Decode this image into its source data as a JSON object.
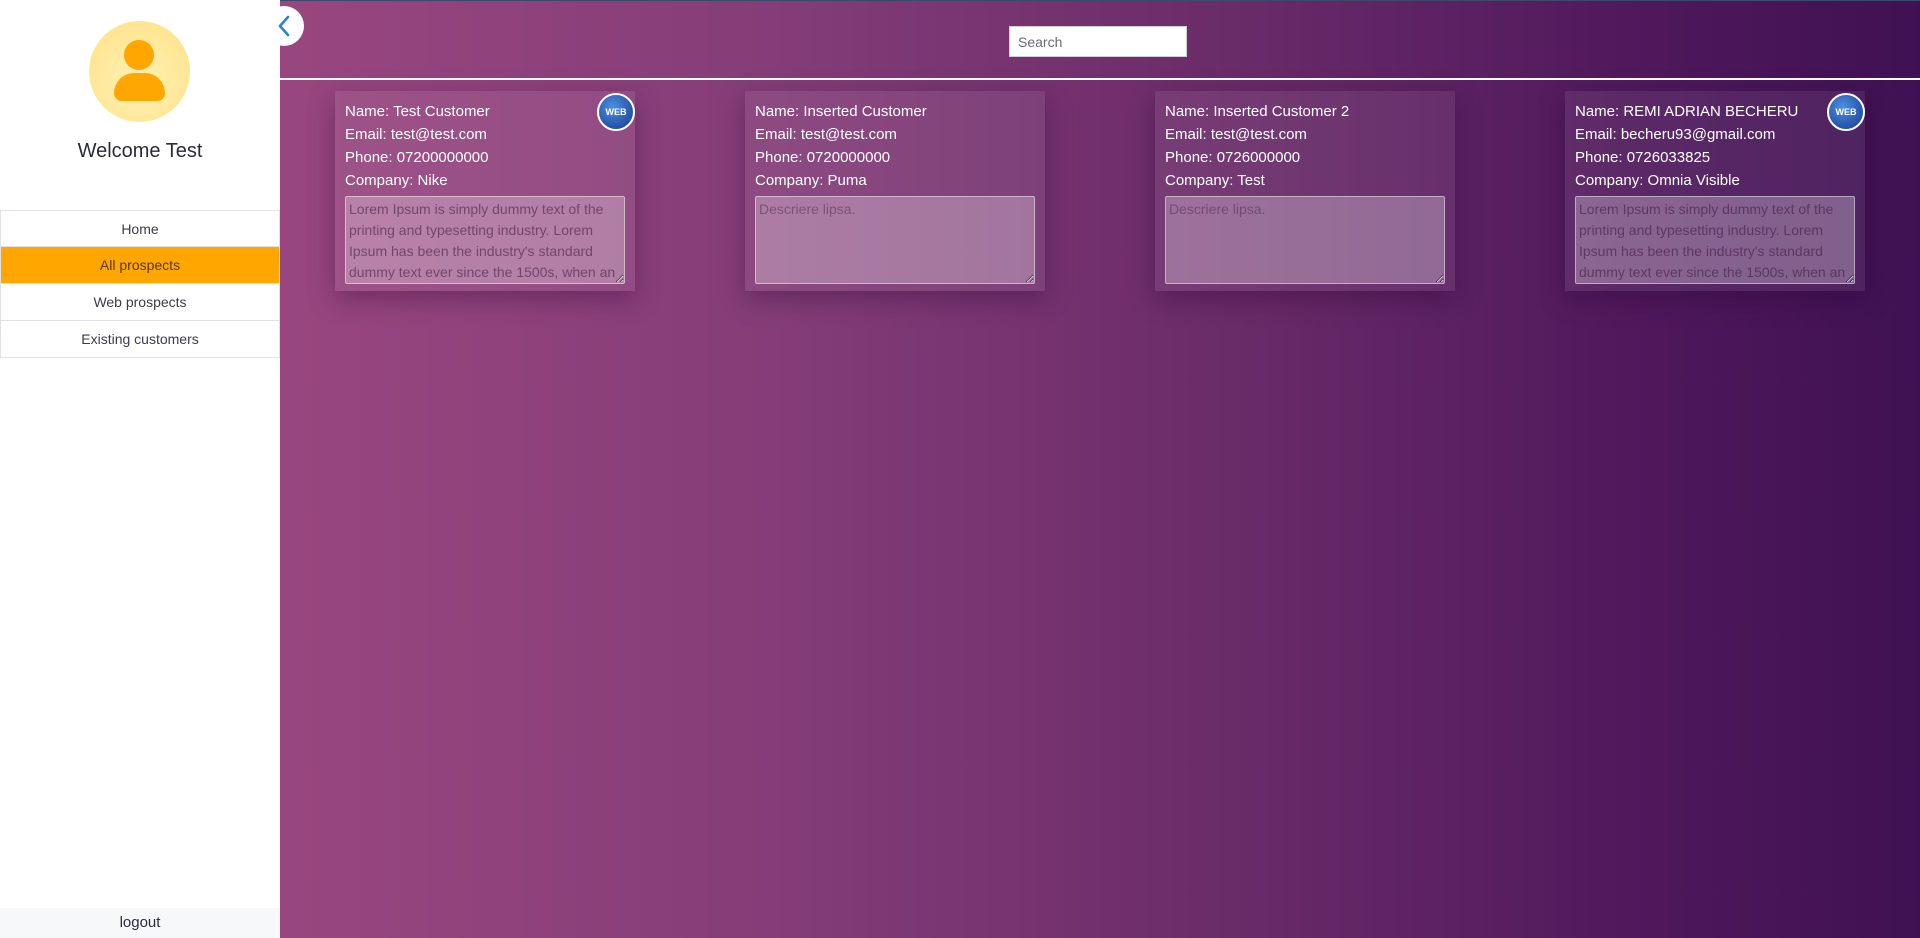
{
  "sidebar": {
    "welcome": "Welcome Test",
    "nav": [
      "Home",
      "All prospects",
      "Web prospects",
      "Existing customers"
    ],
    "active_index": 1,
    "logout": "logout"
  },
  "header": {
    "search_placeholder": "Search"
  },
  "cards": [
    {
      "name": "Name: Test Customer",
      "email": "Email: test@test.com",
      "phone": "Phone: 07200000000",
      "company": "Company: Nike",
      "description": "Lorem Ipsum is simply dummy text of the printing and typesetting industry. Lorem Ipsum has been the industry's standard dummy text ever since the 1500s, when an",
      "placeholder": "Descriere lipsa.",
      "badge": "WEB"
    },
    {
      "name": "Name: Inserted Customer",
      "email": "Email: test@test.com",
      "phone": "Phone: 0720000000",
      "company": "Company: Puma",
      "description": "",
      "placeholder": "Descriere lipsa.",
      "badge": ""
    },
    {
      "name": "Name: Inserted Customer 2",
      "email": "Email: test@test.com",
      "phone": "Phone: 0726000000",
      "company": "Company: Test",
      "description": "",
      "placeholder": "Descriere lipsa.",
      "badge": ""
    },
    {
      "name": "Name: REMI ADRIAN BECHERU",
      "email": "Email: becheru93@gmail.com",
      "phone": "Phone: 0726033825",
      "company": "Company: Omnia Visible",
      "description": "Lorem Ipsum is simply dummy text of the printing and typesetting industry. Lorem Ipsum has been the industry's standard dummy text ever since the 1500s, when an",
      "placeholder": "Descriere lipsa.",
      "badge": "WEB"
    }
  ],
  "colors": {
    "accent": "#ffa600",
    "gradient_start": "#99467f",
    "gradient_end": "#3f1153",
    "badge": "#2a5bb0"
  }
}
